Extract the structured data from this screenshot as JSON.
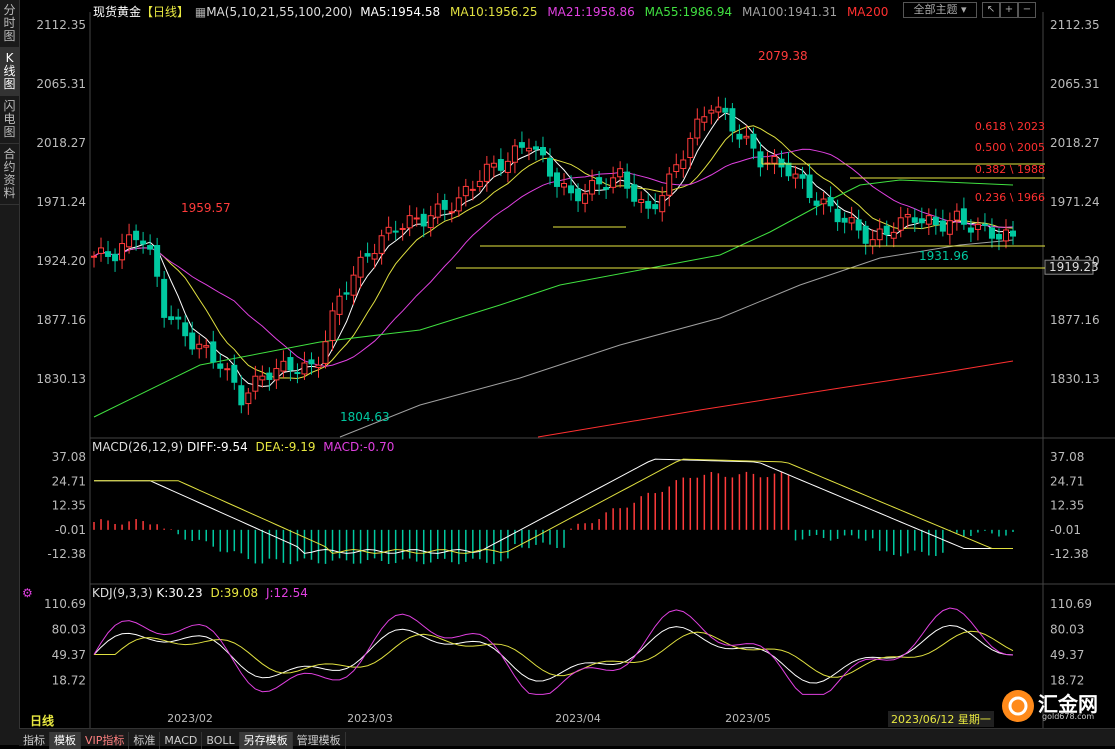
{
  "side_tabs": [
    "分时图",
    "K线图",
    "闪电图",
    "合约资料"
  ],
  "header": {
    "symbol": "现货黄金",
    "period_tag": "【日线】",
    "ma_spec": "MA(5,10,21,55,100,200)",
    "ma5": "MA5:1954.58",
    "ma10": "MA10:1956.25",
    "ma21": "MA21:1958.86",
    "ma55": "MA55:1986.94",
    "ma100": "MA100:1941.31",
    "ma200": "MA200",
    "topic_btn": "全部主题"
  },
  "price_axis": [
    "2112.35",
    "2065.31",
    "2018.27",
    "1971.24",
    "1924.20",
    "1877.16",
    "1830.13"
  ],
  "right_price_labels": [
    "2112.35",
    "2065.31",
    "2018.27",
    "1971.24",
    "1924.20",
    "1919.23",
    "1877.16",
    "1830.13"
  ],
  "annotations": {
    "high1": "1959.57",
    "low1": "1804.63",
    "high2": "2079.38",
    "low2": "1931.96",
    "fib": [
      "0.618 \\ 2023",
      "0.500 \\ 2005",
      "0.382 \\ 1988",
      "0.236 \\ 1966"
    ]
  },
  "macd": {
    "title": "MACD(26,12,9)",
    "diff": "DIFF:-9.54",
    "dea": "DEA:-9.19",
    "macd": "MACD:-0.70",
    "axis": [
      "37.08",
      "24.71",
      "12.35",
      "-0.01",
      "-12.38"
    ]
  },
  "kdj": {
    "title": "KDJ(9,3,3)",
    "k": "K:30.23",
    "d": "D:39.08",
    "j": "J:12.54",
    "axis": [
      "110.69",
      "80.03",
      "49.37",
      "18.72"
    ]
  },
  "dates": [
    "2023/02",
    "2023/03",
    "2023/04",
    "2023/05"
  ],
  "cursor_date": "2023/06/12 星期一",
  "period_label": "日线",
  "bottom_tabs": [
    "指标",
    "模板",
    "VIP指标",
    "标准",
    "MACD",
    "BOLL",
    "另存模板",
    "管理模板"
  ],
  "logo_text": "汇金网",
  "logo_url": "gold678.com",
  "colors": {
    "up": "#ff3b3b",
    "down": "#00c8a0",
    "ma5": "#ffffff",
    "ma10": "#e0e040",
    "ma21": "#e040e0",
    "ma55": "#40e040",
    "ma100": "#a0a0a0",
    "ma200": "#ff3030",
    "fib": "#ff3030",
    "level": "#e8e840"
  }
}
